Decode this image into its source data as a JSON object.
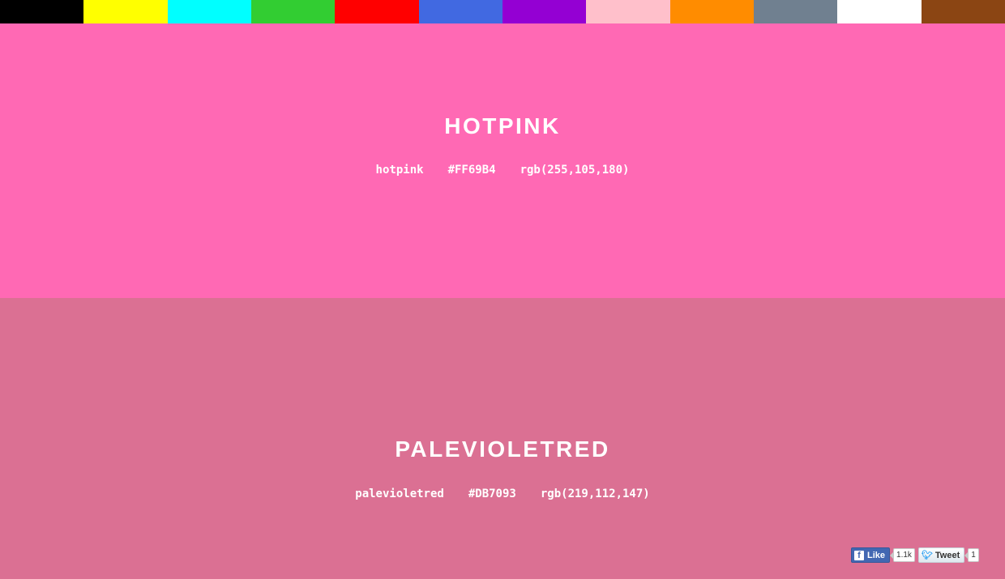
{
  "palette": [
    {
      "color": "#000000"
    },
    {
      "color": "#FFFF00"
    },
    {
      "color": "#00FFFF"
    },
    {
      "color": "#32CD32"
    },
    {
      "color": "#FF0000"
    },
    {
      "color": "#4169E1"
    },
    {
      "color": "#9400D3"
    },
    {
      "color": "#FFC0CB"
    },
    {
      "color": "#FF8C00"
    },
    {
      "color": "#708090"
    },
    {
      "color": "#FFFFFF"
    },
    {
      "color": "#8B4513"
    }
  ],
  "sections": [
    {
      "title": "HOTPINK",
      "name": "hotpink",
      "hex": "#FF69B4",
      "rgb": "rgb(255,105,180)",
      "background": "#FF69B4"
    },
    {
      "title": "PALEVIOLETRED",
      "name": "palevioletred",
      "hex": "#DB7093",
      "rgb": "rgb(219,112,147)",
      "background": "#DB7093"
    }
  ],
  "social": {
    "like_label": "Like",
    "like_count": "1.1k",
    "tweet_label": "Tweet",
    "tweet_count": "1",
    "facebook_icon": "facebook-f-icon",
    "twitter_icon": "twitter-bird-icon"
  }
}
